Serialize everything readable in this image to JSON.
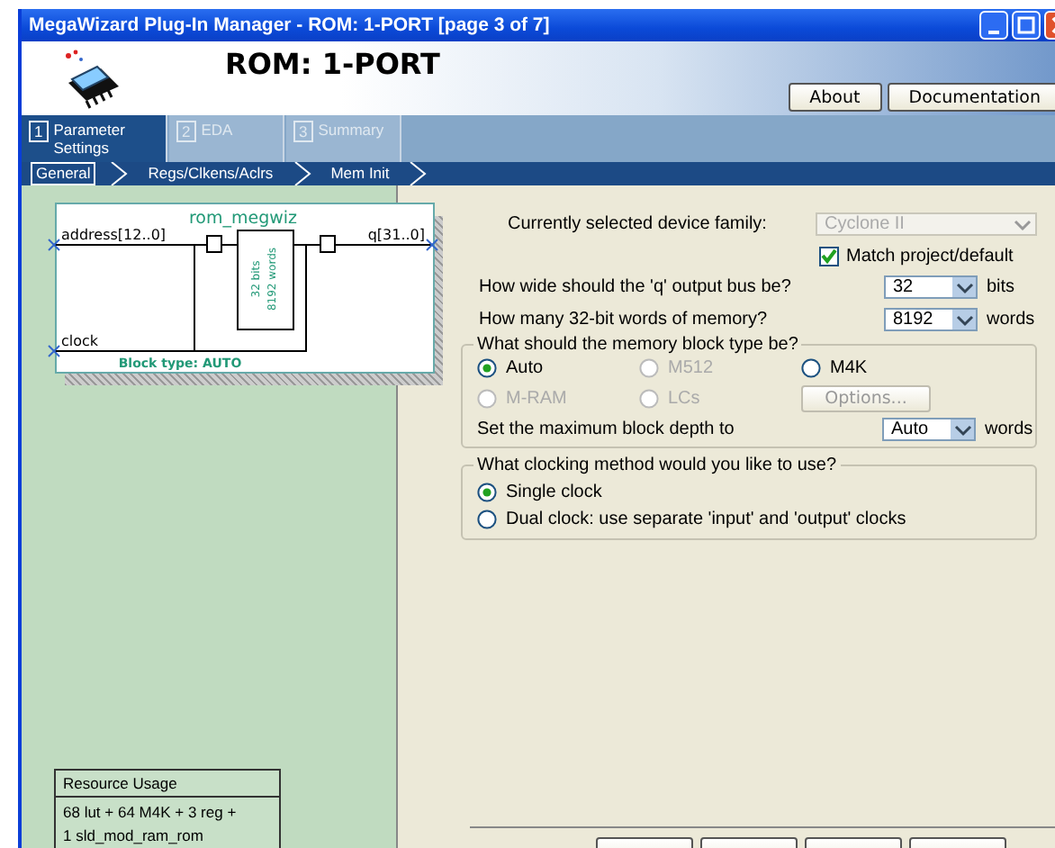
{
  "window": {
    "title": "MegaWizard Plug-In Manager - ROM: 1-PORT [page 3 of 7]"
  },
  "header": {
    "title": "ROM: 1-PORT",
    "buttons": [
      "About",
      "Documentation"
    ]
  },
  "tabs": [
    {
      "number": "1",
      "label": "Parameter Settings",
      "selected": true
    },
    {
      "number": "2",
      "label": "EDA",
      "selected": false
    },
    {
      "number": "3",
      "label": "Summary",
      "selected": false
    }
  ],
  "subtabs": [
    {
      "label": "General",
      "selected": true
    },
    {
      "label": "Regs/Clkens/Aclrs",
      "selected": false
    },
    {
      "label": "Mem Init",
      "selected": false
    }
  ],
  "diagram": {
    "name": "rom_megwiz",
    "input": "address[12..0]",
    "output": "q[31..0]",
    "clock": "clock",
    "memory_lines": [
      "32 bits",
      "8192 words"
    ],
    "block_type": "Block type: AUTO"
  },
  "resource_usage": {
    "title": "Resource Usage",
    "lines": [
      "68 lut + 64 M4K + 3 reg +",
      "1 sld_mod_ram_rom"
    ]
  },
  "device": {
    "label": "Currently selected device family:",
    "value": "Cyclone II",
    "disabled": true,
    "match_label": "Match project/default",
    "match_checked": true
  },
  "bus_width": {
    "label": "How wide should the 'q' output bus be?",
    "value": "32",
    "unit": "bits"
  },
  "words": {
    "label": "How many 32-bit words of memory?",
    "value": "8192",
    "unit": "words"
  },
  "block_type": {
    "title": "What should the memory block type be?",
    "options": [
      {
        "label": "Auto",
        "selected": true,
        "disabled": false
      },
      {
        "label": "M512",
        "selected": false,
        "disabled": true
      },
      {
        "label": "M4K",
        "selected": false,
        "disabled": false
      },
      {
        "label": "M-RAM",
        "selected": false,
        "disabled": true
      },
      {
        "label": "LCs",
        "selected": false,
        "disabled": true
      }
    ],
    "options_button": {
      "label": "Options...",
      "disabled": true
    },
    "depth_label": "Set the maximum block depth to",
    "depth_value": "Auto",
    "depth_unit": "words"
  },
  "clocking": {
    "title": "What clocking method would you like to use?",
    "options": [
      {
        "label": "Single clock",
        "selected": true
      },
      {
        "label": "Dual clock: use separate 'input' and 'output' clocks",
        "selected": false
      }
    ]
  }
}
